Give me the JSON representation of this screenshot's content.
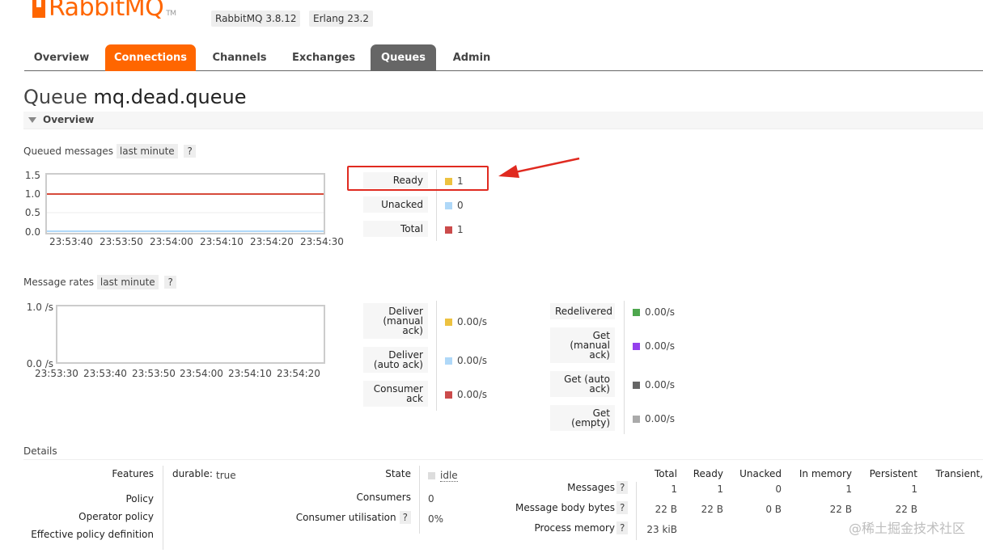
{
  "app": {
    "logo": "RabbitMQ",
    "tm": "TM",
    "version_label": "RabbitMQ 3.8.12",
    "erlang_label": "Erlang 23.2"
  },
  "tabs": [
    "Overview",
    "Connections",
    "Channels",
    "Exchanges",
    "Queues",
    "Admin"
  ],
  "page": {
    "title_prefix": "Queue",
    "queue_name": "mq.dead.queue"
  },
  "overview_section": "Overview",
  "queued": {
    "title": "Queued messages",
    "range": "last minute",
    "help": "?",
    "y_ticks": [
      "1.5",
      "1.0",
      "0.5",
      "0.0"
    ],
    "x_ticks": [
      "23:53:40",
      "23:53:50",
      "23:54:00",
      "23:54:10",
      "23:54:20",
      "23:54:30"
    ],
    "legend": [
      {
        "label": "Ready",
        "value": "1",
        "color": "#edc240"
      },
      {
        "label": "Unacked",
        "value": "0",
        "color": "#afd8f8"
      },
      {
        "label": "Total",
        "value": "1",
        "color": "#cb4b4b"
      }
    ]
  },
  "rates": {
    "title": "Message rates",
    "range": "last minute",
    "help": "?",
    "y_ticks": [
      "1.0 /s",
      "0.0 /s"
    ],
    "x_ticks": [
      "23:53:30",
      "23:53:40",
      "23:53:50",
      "23:54:00",
      "23:54:10",
      "23:54:20"
    ],
    "left": [
      {
        "label": "Deliver\n(manual\nack)",
        "value": "0.00/s",
        "color": "#edc240"
      },
      {
        "label": "Deliver\n(auto ack)",
        "value": "0.00/s",
        "color": "#afd8f8"
      },
      {
        "label": "Consumer\nack",
        "value": "0.00/s",
        "color": "#cb4b4b"
      }
    ],
    "right": [
      {
        "label": "Redelivered",
        "value": "0.00/s",
        "color": "#4da74d"
      },
      {
        "label": "Get\n(manual\nack)",
        "value": "0.00/s",
        "color": "#9440ed"
      },
      {
        "label": "Get (auto\nack)",
        "value": "0.00/s",
        "color": "#666666"
      },
      {
        "label": "Get\n(empty)",
        "value": "0.00/s",
        "color": "#aaaaaa"
      }
    ]
  },
  "details": {
    "title": "Details",
    "features_label": "Features",
    "durable_key": "durable:",
    "durable_val": "true",
    "policy_label": "Policy",
    "operator_policy_label": "Operator policy",
    "effective_policy_label": "Effective policy definition",
    "state_label": "State",
    "state_val": "idle",
    "consumers_label": "Consumers",
    "consumers_val": "0",
    "utilisation_label": "Consumer utilisation",
    "utilisation_val": "0%",
    "help": "?",
    "table_headers": [
      "Total",
      "Ready",
      "Unacked",
      "In memory",
      "Persistent",
      "Transient,"
    ],
    "rows": [
      {
        "label": "Messages",
        "cells": [
          "1",
          "1",
          "0",
          "1",
          "1"
        ]
      },
      {
        "label": "Message body bytes",
        "cells": [
          "22 B",
          "22 B",
          "0 B",
          "22 B",
          "22 B"
        ]
      },
      {
        "label": "Process memory",
        "cells": [
          "23 kiB"
        ]
      }
    ]
  },
  "watermark": "@稀土掘金技术社区"
}
